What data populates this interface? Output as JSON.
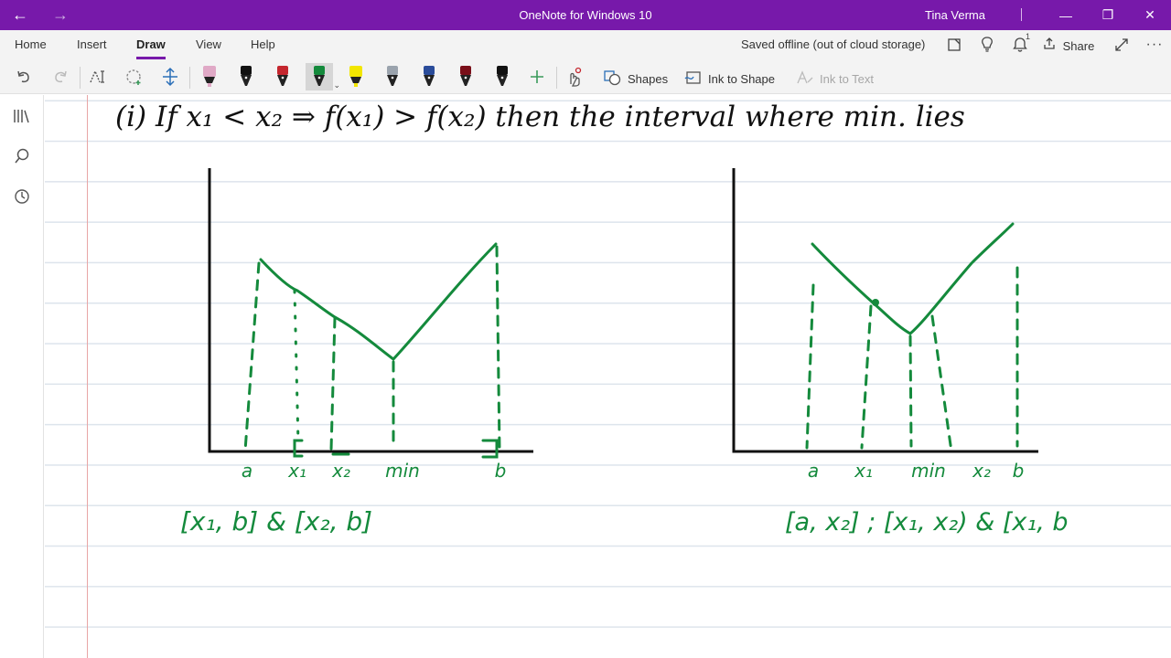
{
  "window": {
    "title": "OneNote for Windows 10",
    "user": "Tina Verma"
  },
  "ribbon": {
    "tabs": [
      "Home",
      "Insert",
      "Draw",
      "View",
      "Help"
    ],
    "active_tab": "Draw",
    "status": "Saved offline (out of cloud storage)",
    "notification_count": "1",
    "share_label": "Share",
    "shapes_label": "Shapes",
    "ink_to_shape_label": "Ink to Shape",
    "ink_to_text_label": "Ink to Text",
    "pens": [
      {
        "name": "pink-highlighter",
        "color": "#e0a9c6"
      },
      {
        "name": "black-pen",
        "color": "#111111"
      },
      {
        "name": "red-pen",
        "color": "#c4262e"
      },
      {
        "name": "green-pen",
        "color": "#148a3c",
        "selected": true
      },
      {
        "name": "yellow-highlighter",
        "color": "#f2e600"
      },
      {
        "name": "galaxy-pen",
        "color": "#9aa3ad"
      },
      {
        "name": "blue-black-pen",
        "color": "#2a4c9a"
      },
      {
        "name": "dark-red-pen",
        "color": "#7a0f19"
      },
      {
        "name": "black-pen-2",
        "color": "#111111"
      }
    ]
  },
  "note": {
    "heading": "(i) If  x₁ < x₂  ⇒  f(x₁) > f(x₂)  then the interval where min. lies",
    "graph1": {
      "tick_labels": [
        "a",
        "x₁",
        "x₂",
        "min",
        "b"
      ],
      "answer": "[x₁, b]  &  [x₂, b]"
    },
    "graph2": {
      "tick_labels": [
        "a",
        "x₁",
        "min",
        "x₂",
        "b"
      ],
      "answer": "[a, x₂] ;  [x₁, x₂)  &  [x₁, b"
    },
    "ink_color": "#148a3c"
  }
}
